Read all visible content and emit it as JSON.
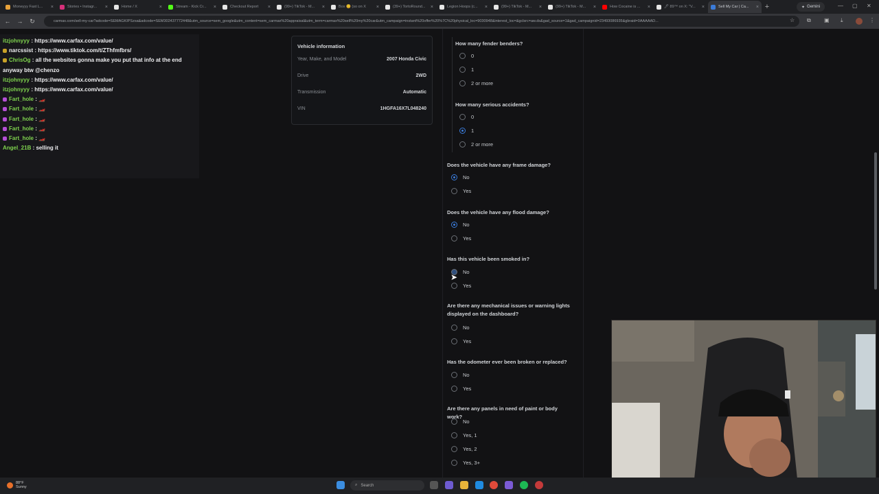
{
  "browser": {
    "tabs": [
      {
        "title": "Moneyyy Fast L...",
        "color": "#e8a23a"
      },
      {
        "title": "Stories • Instagr...",
        "color": "#d6307a"
      },
      {
        "title": "Home / X",
        "color": "#e6e6e6"
      },
      {
        "title": "Stream - Kick Cr...",
        "color": "#53fc18"
      },
      {
        "title": "Checkout Report",
        "color": "#e6e6e6"
      },
      {
        "title": "(99+) TikTok - M...",
        "color": "#e6e6e6"
      },
      {
        "title": "Box 😊 (so on X",
        "color": "#e6e6e6"
      },
      {
        "title": "(39+) TortoRound...",
        "color": "#e6e6e6"
      },
      {
        "title": "Legion Hoops (c...",
        "color": "#e6e6e6"
      },
      {
        "title": "(99+) TikTok - M...",
        "color": "#e6e6e6"
      },
      {
        "title": "(99+) TikTok - M...",
        "color": "#e6e6e6"
      },
      {
        "title": "How Cocaine is ...",
        "color": "#ff0000"
      },
      {
        "title": "🖊 89™ on X: \"V...",
        "color": "#e6e6e6"
      },
      {
        "title": "Sell My Car | Ca...",
        "color": "#3b7bd8"
      }
    ],
    "gemini_label": "Gemini",
    "url": "carmax.com/sell-my-car?adcode=SEMAGKIPSzsa&adcode=SEM302437772448&utm_source=sem_google&utm_content=sem_carmax%20appraisal&utm_term=carmax%20sell%20my%20car&utm_campaign=instant%20offer%20%7C%20physical_loc=9030948&interest_loc=&gclsrc=aw.ds&gad_source=1&gad_campaignid=23493086935&gbraid=0AAAAAD..."
  },
  "chat": {
    "messages": [
      {
        "user": "itzjohnyyy",
        "text": ": https://www.carfax.com/value/",
        "color": "#7fd34e",
        "badge": ""
      },
      {
        "user": "narcssist",
        "text": ": https://www.tiktok.com/t/ZThfmfbrs/",
        "color": "#efeff1",
        "badge": "#c9a227"
      },
      {
        "user": "ChrisOg",
        "text": ": all the websites gonna make you put that info at the end anyway btw @chenzo",
        "color": "#7fd34e",
        "badge": "#c9a227"
      },
      {
        "user": "itzjohnyyy",
        "text": ": https://www.carfax.com/value/",
        "color": "#7fd34e",
        "badge": ""
      },
      {
        "user": "itzjohnyyy",
        "text": ": https://www.carfax.com/value/",
        "color": "#7fd34e",
        "badge": ""
      },
      {
        "user": "Fart_hole",
        "text": ": 🏎️",
        "color": "#7fd34e",
        "badge": "#b44fd6"
      },
      {
        "user": "Fart_hole",
        "text": ": 🏎️",
        "color": "#7fd34e",
        "badge": "#b44fd6"
      },
      {
        "user": "Fart_hole",
        "text": ": 🏎️",
        "color": "#7fd34e",
        "badge": "#b44fd6"
      },
      {
        "user": "Fart_hole",
        "text": ": 🏎️",
        "color": "#7fd34e",
        "badge": "#b44fd6"
      },
      {
        "user": "Fart_hole",
        "text": ": 🏎️",
        "color": "#7fd34e",
        "badge": "#b44fd6"
      },
      {
        "user": "Angel_21B",
        "text": ": selling it",
        "color": "#7fd34e",
        "badge": ""
      }
    ]
  },
  "vehicle": {
    "title": "Vehicle information",
    "rows": [
      {
        "label": "Year, Make, and Model",
        "value": "2007 Honda Civic"
      },
      {
        "label": "Drive",
        "value": "2WD"
      },
      {
        "label": "Transmission",
        "value": "Automatic"
      },
      {
        "label": "VIN",
        "value": "1HGFA16X7L048240"
      }
    ]
  },
  "form": {
    "fender_q": "How many fender benders?",
    "fender_opts": [
      "0",
      "1",
      "2 or more"
    ],
    "fender_selected": null,
    "serious_q": "How many serious accidents?",
    "serious_opts": [
      "0",
      "1",
      "2 or more"
    ],
    "serious_selected": 1,
    "frame_q": "Does the vehicle have any frame damage?",
    "frame_opts": [
      "No",
      "Yes"
    ],
    "frame_selected": 0,
    "flood_q": "Does the vehicle have any flood damage?",
    "flood_opts": [
      "No",
      "Yes"
    ],
    "flood_selected": 0,
    "smoked_q": "Has this vehicle been smoked in?",
    "smoked_opts": [
      "No",
      "Yes"
    ],
    "mech_q": "Are there any mechanical issues or warning lights displayed on the dashboard?",
    "mech_opts": [
      "No",
      "Yes"
    ],
    "odo_q": "Has the odometer ever been broken or replaced?",
    "odo_opts": [
      "No",
      "Yes"
    ],
    "panels_q": "Are there any panels in need of paint or body work?",
    "panels_opts": [
      "No",
      "Yes, 1",
      "Yes, 2",
      "Yes, 3+"
    ]
  },
  "taskbar": {
    "temp": "88°F",
    "weather": "Sunny",
    "search_placeholder": "Search"
  }
}
